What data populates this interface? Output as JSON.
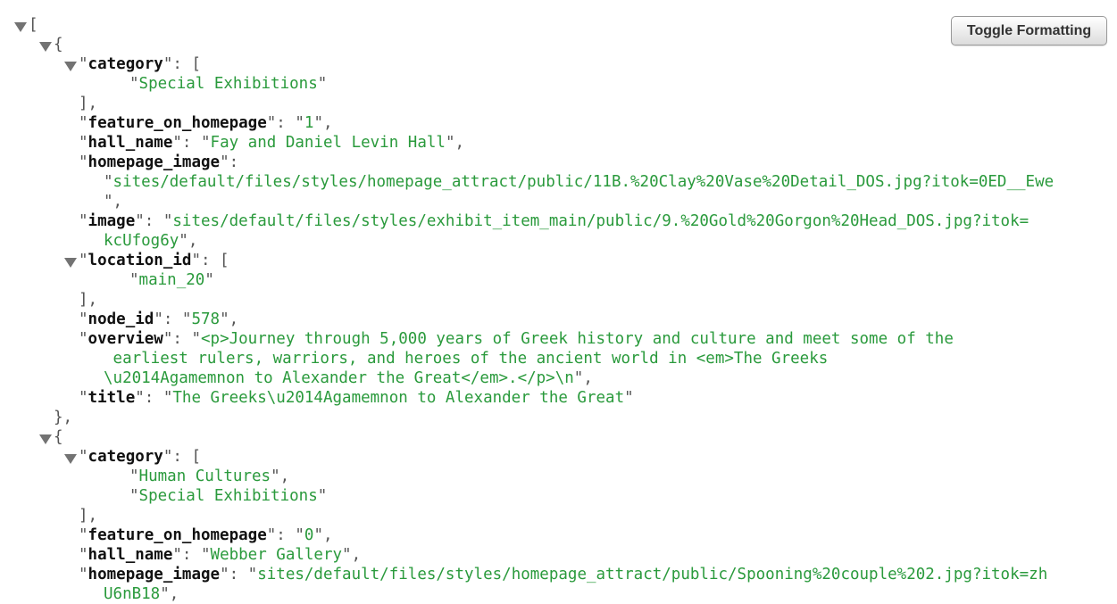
{
  "toolbar": {
    "toggle_label": "Toggle Formatting"
  },
  "icons": {
    "collapse": "triangle-down-icon"
  },
  "colors": {
    "key": "#111111",
    "string": "#2a9a3c",
    "punct": "#555555",
    "toggle": "#737373"
  },
  "root_open": "[",
  "items": [
    {
      "open": "{",
      "category_key": "category",
      "category": [
        "Special Exhibitions"
      ],
      "feature_key": "feature_on_homepage",
      "feature": "1",
      "hall_key": "hall_name",
      "hall_name": "Fay and Daniel Levin Hall",
      "homepage_image_key": "homepage_image",
      "homepage_image": "sites/default/files/styles/homepage_attract/public/11B.%20Clay%20Vase%20Detail_DOS.jpg?itok=0ED__Ewe",
      "image_key": "image",
      "image": "sites/default/files/styles/exhibit_item_main/public/9.%20Gold%20Gorgon%20Head_DOS.jpg?itok=kcUfog6y",
      "location_key": "location_id",
      "location_id": [
        "main_20"
      ],
      "node_key": "node_id",
      "node_id": "578",
      "overview_key": "overview",
      "overview": "<p>Journey through 5,000 years of Greek history and culture and meet some of the earliest rulers, warriors, and heroes of the ancient world in <em>The Greeks\\u2014Agamemnon to Alexander the Great</em>.</p>\\n",
      "title_key": "title",
      "title": "The Greeks\\u2014Agamemnon to Alexander the Great",
      "close": "},"
    },
    {
      "open": "{",
      "category_key": "category",
      "category": [
        "Human Cultures",
        "Special Exhibitions"
      ],
      "feature_key": "feature_on_homepage",
      "feature": "0",
      "hall_key": "hall_name",
      "hall_name": "Webber Gallery",
      "homepage_image_key": "homepage_image",
      "homepage_image": "sites/default/files/styles/homepage_attract/public/Spooning%20couple%202.jpg?itok=zhU6nB18"
    }
  ]
}
